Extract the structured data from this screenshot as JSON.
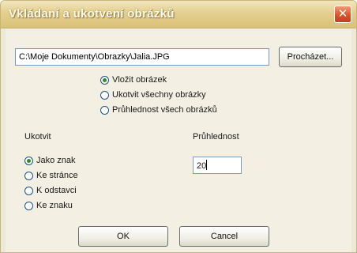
{
  "window": {
    "title": "Vkládaní a ukotvení obrázků",
    "close_glyph": "✕"
  },
  "path_field": {
    "value": "C:\\Moje Dokumenty\\Obrazky\\Jalia.JPG"
  },
  "browse_button": {
    "label": "Procházet..."
  },
  "action_options": [
    {
      "label": "Vložit obrázek",
      "checked": true
    },
    {
      "label": "Ukotvit všechny obrázky",
      "checked": false
    },
    {
      "label": "Průhlednost všech obrázků",
      "checked": false
    }
  ],
  "anchor_group": {
    "label": "Ukotvit",
    "options": [
      {
        "label": "Jako znak",
        "checked": true
      },
      {
        "label": "Ke stránce",
        "checked": false
      },
      {
        "label": "K odstavci",
        "checked": false
      },
      {
        "label": "Ke znaku",
        "checked": false
      }
    ]
  },
  "transparency": {
    "label": "Průhlednost",
    "value": "20"
  },
  "ok_button": {
    "label": "OK"
  },
  "cancel_button": {
    "label": "Cancel"
  }
}
